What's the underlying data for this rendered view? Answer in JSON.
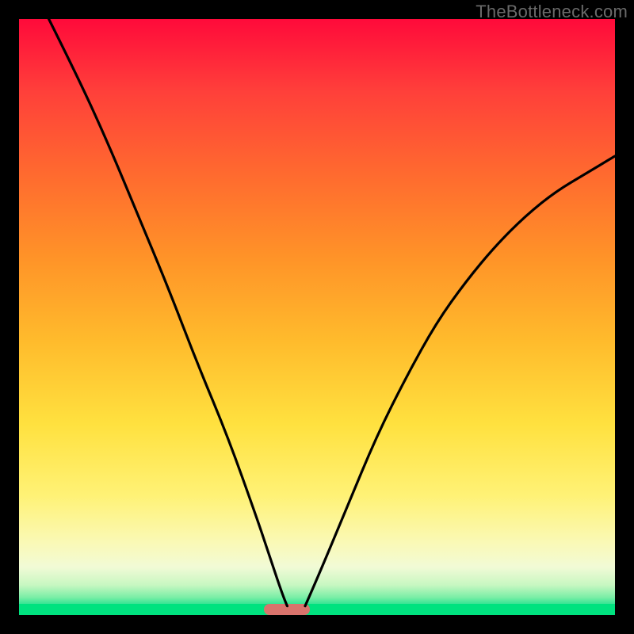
{
  "watermark": "TheBottleneck.com",
  "chart_data": {
    "type": "line",
    "title": "",
    "xlabel": "",
    "ylabel": "",
    "x_range_pct": [
      0,
      100
    ],
    "y_range_pct": [
      0,
      100
    ],
    "minimum_x_pct": 45,
    "marker": {
      "x_pct": 45,
      "width_pct": 7.7,
      "color": "#d9736c"
    },
    "axes_hidden": true,
    "series": [
      {
        "name": "left_branch",
        "x_pct": [
          5,
          10,
          15,
          20,
          25,
          30,
          35,
          40,
          42,
          44,
          45
        ],
        "y_pct": [
          100,
          90,
          79,
          67,
          55,
          42,
          30,
          16,
          10,
          4,
          1.5
        ]
      },
      {
        "name": "right_branch",
        "x_pct": [
          48,
          50,
          55,
          60,
          65,
          70,
          75,
          80,
          85,
          90,
          95,
          100
        ],
        "y_pct": [
          1.5,
          6,
          18,
          30,
          40,
          49,
          56,
          62,
          67,
          71,
          74,
          77
        ]
      }
    ],
    "gradient_stops": [
      {
        "pct": 0,
        "color": "#ff0a3a"
      },
      {
        "pct": 12,
        "color": "#ff3f3a"
      },
      {
        "pct": 26,
        "color": "#ff6a2f"
      },
      {
        "pct": 40,
        "color": "#ff9328"
      },
      {
        "pct": 54,
        "color": "#ffbb2c"
      },
      {
        "pct": 68,
        "color": "#ffe13f"
      },
      {
        "pct": 80,
        "color": "#fff276"
      },
      {
        "pct": 88,
        "color": "#faf9b7"
      },
      {
        "pct": 92,
        "color": "#f1fad6"
      },
      {
        "pct": 95,
        "color": "#c7f7c1"
      },
      {
        "pct": 97,
        "color": "#7ceea7"
      },
      {
        "pct": 98.5,
        "color": "#21e28e"
      },
      {
        "pct": 100,
        "color": "#00d97d"
      }
    ]
  }
}
